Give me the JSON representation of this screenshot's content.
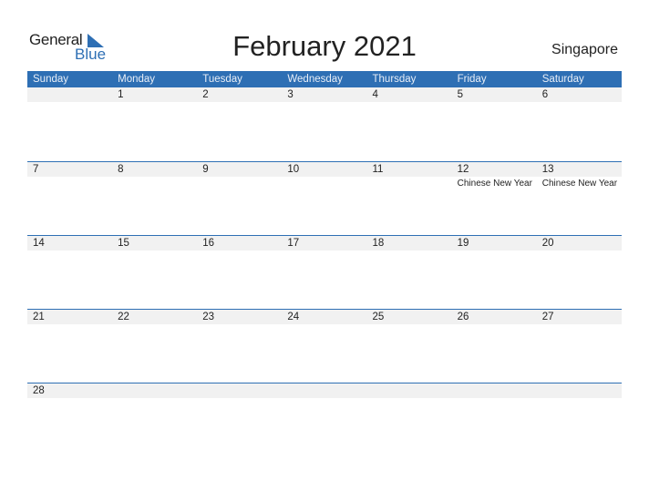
{
  "logo": {
    "text_top": "General",
    "text_bottom": "Blue"
  },
  "title": "February 2021",
  "country": "Singapore",
  "colors": {
    "accent": "#2e6fb4",
    "band": "#f1f1f1"
  },
  "weekdays": [
    "Sunday",
    "Monday",
    "Tuesday",
    "Wednesday",
    "Thursday",
    "Friday",
    "Saturday"
  ],
  "weeks": [
    [
      {
        "day": ""
      },
      {
        "day": "1"
      },
      {
        "day": "2"
      },
      {
        "day": "3"
      },
      {
        "day": "4"
      },
      {
        "day": "5"
      },
      {
        "day": "6"
      }
    ],
    [
      {
        "day": "7"
      },
      {
        "day": "8"
      },
      {
        "day": "9"
      },
      {
        "day": "10"
      },
      {
        "day": "11"
      },
      {
        "day": "12",
        "event": "Chinese New Year"
      },
      {
        "day": "13",
        "event": "Chinese New Year"
      }
    ],
    [
      {
        "day": "14"
      },
      {
        "day": "15"
      },
      {
        "day": "16"
      },
      {
        "day": "17"
      },
      {
        "day": "18"
      },
      {
        "day": "19"
      },
      {
        "day": "20"
      }
    ],
    [
      {
        "day": "21"
      },
      {
        "day": "22"
      },
      {
        "day": "23"
      },
      {
        "day": "24"
      },
      {
        "day": "25"
      },
      {
        "day": "26"
      },
      {
        "day": "27"
      }
    ],
    [
      {
        "day": "28"
      },
      {
        "day": ""
      },
      {
        "day": ""
      },
      {
        "day": ""
      },
      {
        "day": ""
      },
      {
        "day": ""
      },
      {
        "day": ""
      }
    ]
  ]
}
